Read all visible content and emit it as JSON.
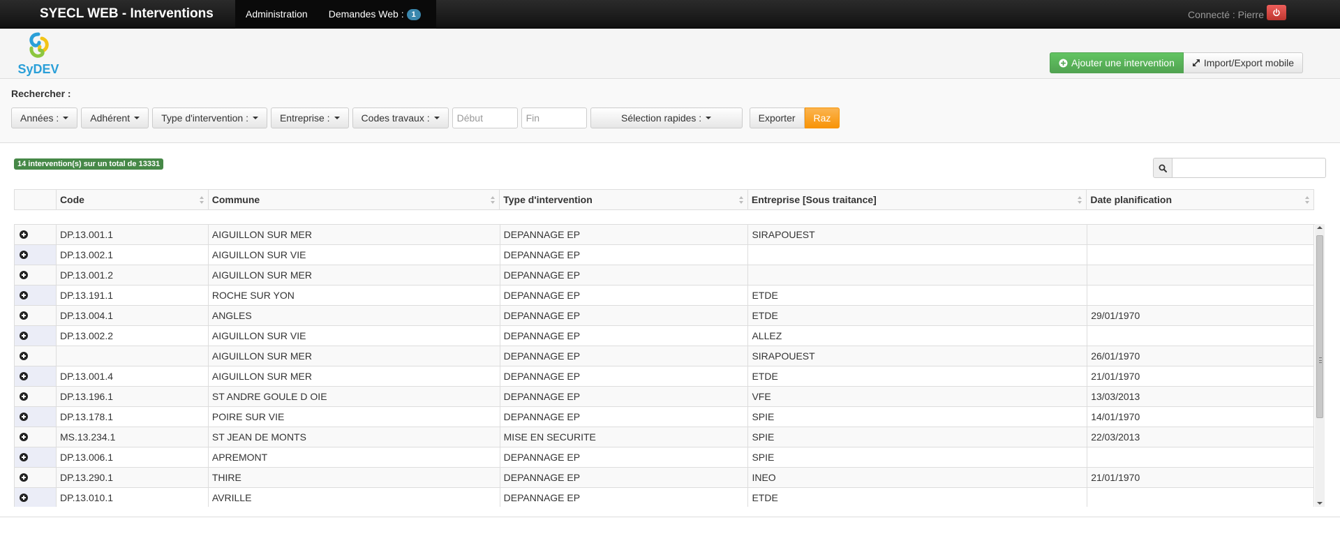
{
  "navbar": {
    "brand": "SYECL WEB - Interventions",
    "links": [
      {
        "label": "Administration"
      },
      {
        "label": "Demandes Web :",
        "badge": "1"
      }
    ],
    "user": "Connecté : Pierre"
  },
  "logo": {
    "text": "SyDEV"
  },
  "header": {
    "add_button": "Ajouter une intervention",
    "import_button": "Import/Export mobile"
  },
  "search": {
    "label": "Rechercher :",
    "filters": {
      "annees": "Années :",
      "adherent": "Adhérent",
      "type": "Type d'intervention :",
      "entreprise": "Entreprise :",
      "codes": "Codes travaux :"
    },
    "debut_placeholder": "Début",
    "fin_placeholder": "Fin",
    "selection": "Sélection rapides :",
    "export": "Exporter",
    "raz": "Raz"
  },
  "table": {
    "count": "14 intervention(s) sur un total de 13331",
    "headers": [
      "Code",
      "Commune",
      "Type d'intervention",
      "Entreprise [Sous traitance]",
      "Date planification"
    ],
    "rows": [
      [
        "DP.13.001.1",
        "AIGUILLON SUR MER",
        "DEPANNAGE EP",
        "SIRAPOUEST",
        ""
      ],
      [
        "DP.13.002.1",
        "AIGUILLON SUR VIE",
        "DEPANNAGE EP",
        "",
        ""
      ],
      [
        "DP.13.001.2",
        "AIGUILLON SUR MER",
        "DEPANNAGE EP",
        "",
        ""
      ],
      [
        "DP.13.191.1",
        "ROCHE SUR YON",
        "DEPANNAGE EP",
        "ETDE",
        ""
      ],
      [
        "DP.13.004.1",
        "ANGLES",
        "DEPANNAGE EP",
        "ETDE",
        "29/01/1970"
      ],
      [
        "DP.13.002.2",
        "AIGUILLON SUR VIE",
        "DEPANNAGE EP",
        "ALLEZ",
        ""
      ],
      [
        "",
        "AIGUILLON SUR MER",
        "DEPANNAGE EP",
        "SIRAPOUEST",
        "26/01/1970"
      ],
      [
        "DP.13.001.4",
        "AIGUILLON SUR MER",
        "DEPANNAGE EP",
        "ETDE",
        "21/01/1970"
      ],
      [
        "DP.13.196.1",
        "ST ANDRE GOULE D OIE",
        "DEPANNAGE EP",
        "VFE",
        "13/03/2013"
      ],
      [
        "DP.13.178.1",
        "POIRE SUR VIE",
        "DEPANNAGE EP",
        "SPIE",
        "14/01/1970"
      ],
      [
        "MS.13.234.1",
        "ST JEAN DE MONTS",
        "MISE EN SECURITE",
        "SPIE",
        "22/03/2013"
      ],
      [
        "DP.13.006.1",
        "APREMONT",
        "DEPANNAGE EP",
        "SPIE",
        ""
      ],
      [
        "DP.13.290.1",
        "THIRE",
        "DEPANNAGE EP",
        "INEO",
        "21/01/1970"
      ],
      [
        "DP.13.010.1",
        "AVRILLE",
        "DEPANNAGE EP",
        "ETDE",
        ""
      ]
    ]
  },
  "colors": {
    "navbar": "#1b1b1b",
    "success": "#5bb75b",
    "warning": "#faa732",
    "danger": "#da4f49",
    "badge_info": "#3a87ad",
    "count_badge": "#468847"
  }
}
